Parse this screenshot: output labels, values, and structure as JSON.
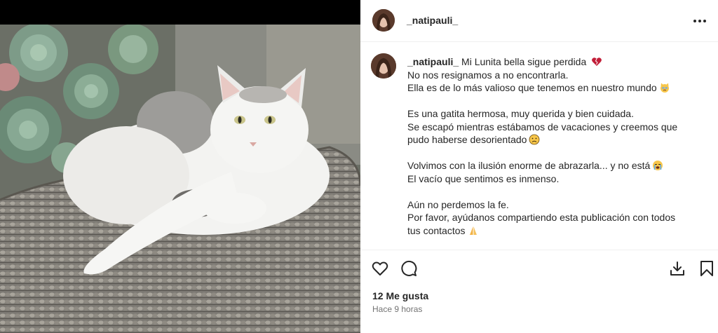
{
  "post": {
    "username": "_natipauli_",
    "caption_username": "_natipauli_",
    "caption_title": "Mi Lunita bella sigue perdida",
    "paragraphs": [
      {
        "lines": [
          {
            "text": "No nos resignamos a no encontrarla."
          },
          {
            "text": "Ella es de lo más valioso que tenemos en nuestro mundo",
            "emoji": "cat-face-emoji"
          }
        ]
      },
      {
        "lines": [
          {
            "text": "Es una gatita hermosa, muy querida y bien cuidada."
          },
          {
            "text": "Se escapó mientras estábamos de vacaciones y creemos que"
          },
          {
            "text": "pudo haberse desorientado",
            "emoji": "frowning-face-emoji"
          }
        ]
      },
      {
        "lines": [
          {
            "text": "Volvimos con la ilusión enorme de abrazarla... y no está",
            "emoji": "crying-face-emoji"
          },
          {
            "text": "El vacío que sentimos es inmenso."
          }
        ]
      },
      {
        "lines": [
          {
            "text": "Aún no perdemos la fe."
          },
          {
            "text": "Por favor, ayúdanos compartiendo esta publicación con todos"
          },
          {
            "text": "tus contactos",
            "emoji": "folded-hands-emoji"
          }
        ]
      }
    ],
    "likes": "12 Me gusta",
    "time": "Hace 9 horas"
  },
  "icons": {
    "more": "more-horizontal-icon",
    "like": "heart-icon",
    "comment": "comment-icon",
    "download": "download-icon",
    "save": "bookmark-icon",
    "title_emoji": "broken-heart-emoji"
  },
  "colors": {
    "text": "#262626",
    "secondary": "#737373",
    "divider": "#efefef",
    "heart_emoji": "#c21e38"
  }
}
